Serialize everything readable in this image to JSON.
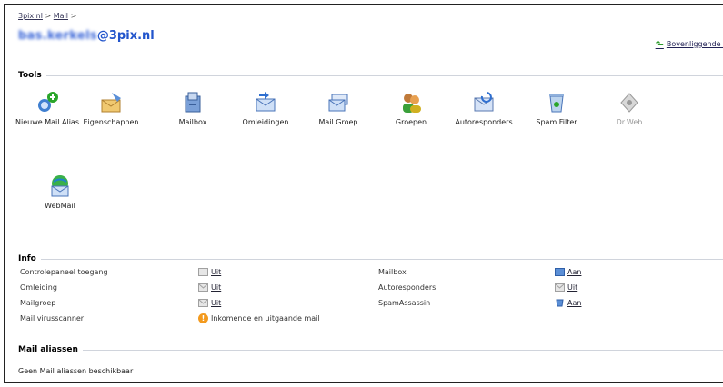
{
  "breadcrumb": {
    "root": "3pix.nl",
    "sep1": ">",
    "mail": "Mail",
    "sep2": ">"
  },
  "account": {
    "user_blurred": "bas.kerkels",
    "domain": "@3pix.nl"
  },
  "up_link": {
    "label": "Bovenliggende Map"
  },
  "sections": {
    "tools": "Tools",
    "info": "Info",
    "aliases": "Mail aliassen"
  },
  "tools": [
    {
      "label": "Nieuwe Mail Alias",
      "icon": "new-alias-icon"
    },
    {
      "label": "Eigenschappen",
      "icon": "properties-icon"
    },
    {
      "label": "Mailbox",
      "icon": "mailbox-icon"
    },
    {
      "label": "Omleidingen",
      "icon": "forwarding-icon"
    },
    {
      "label": "Mail Groep",
      "icon": "mail-group-icon"
    },
    {
      "label": "Groepen",
      "icon": "groups-icon"
    },
    {
      "label": "Autoresponders",
      "icon": "autoresponder-icon"
    },
    {
      "label": "Spam Filter",
      "icon": "spam-filter-icon"
    },
    {
      "label": "Dr.Web",
      "icon": "drweb-icon",
      "disabled": true
    },
    {
      "label": "WebMail",
      "icon": "webmail-icon"
    }
  ],
  "info": {
    "left": [
      {
        "label": "Controlepaneel toegang",
        "status": "Uit"
      },
      {
        "label": "Omleiding",
        "status": "Uit"
      },
      {
        "label": "Mailgroep",
        "status": "Uit"
      },
      {
        "label": "Mail virusscanner",
        "status": "Inkomende en uitgaande mail"
      }
    ],
    "right": [
      {
        "label": "Mailbox",
        "status": "Aan"
      },
      {
        "label": "Autoresponders",
        "status": "Uit"
      },
      {
        "label": "SpamAssassin",
        "status": "Aan"
      }
    ]
  },
  "aliases_empty": "Geen Mail aliassen beschikbaar"
}
